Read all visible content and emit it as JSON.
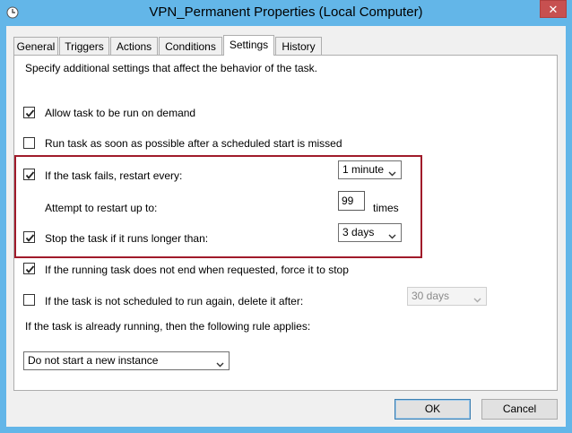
{
  "window": {
    "title": "VPN_Permanent Properties (Local Computer)",
    "close_glyph": "✕"
  },
  "tabs": [
    {
      "label": "General",
      "active": false
    },
    {
      "label": "Triggers",
      "active": false
    },
    {
      "label": "Actions",
      "active": false
    },
    {
      "label": "Conditions",
      "active": false
    },
    {
      "label": "Settings",
      "active": true
    },
    {
      "label": "History",
      "active": false
    }
  ],
  "settings": {
    "intro": "Specify additional settings that affect the behavior of the task.",
    "allow_on_demand": {
      "label": "Allow task to be run on demand",
      "checked": true
    },
    "run_asap": {
      "label": "Run task as soon as possible after a scheduled start is missed",
      "checked": false
    },
    "restart_on_fail": {
      "label": "If the task fails, restart every:",
      "checked": true,
      "value": "1 minute"
    },
    "restart_attempts": {
      "label": "Attempt to restart up to:",
      "value": "99",
      "unit": "times"
    },
    "stop_if_longer": {
      "label": "Stop the task if it runs longer than:",
      "checked": true,
      "value": "3 days"
    },
    "force_stop": {
      "label": "If the running task does not end when requested, force it to stop",
      "checked": true
    },
    "delete_after": {
      "label": "If the task is not scheduled to run again, delete it after:",
      "checked": false,
      "value": "30 days"
    },
    "rule_label": "If the task is already running, then the following rule applies:",
    "rule_value": "Do not start a new instance"
  },
  "buttons": {
    "ok": "OK",
    "cancel": "Cancel"
  },
  "colors": {
    "frame": "#63b6e8",
    "highlight": "#a01b2a",
    "close": "#c75050"
  }
}
